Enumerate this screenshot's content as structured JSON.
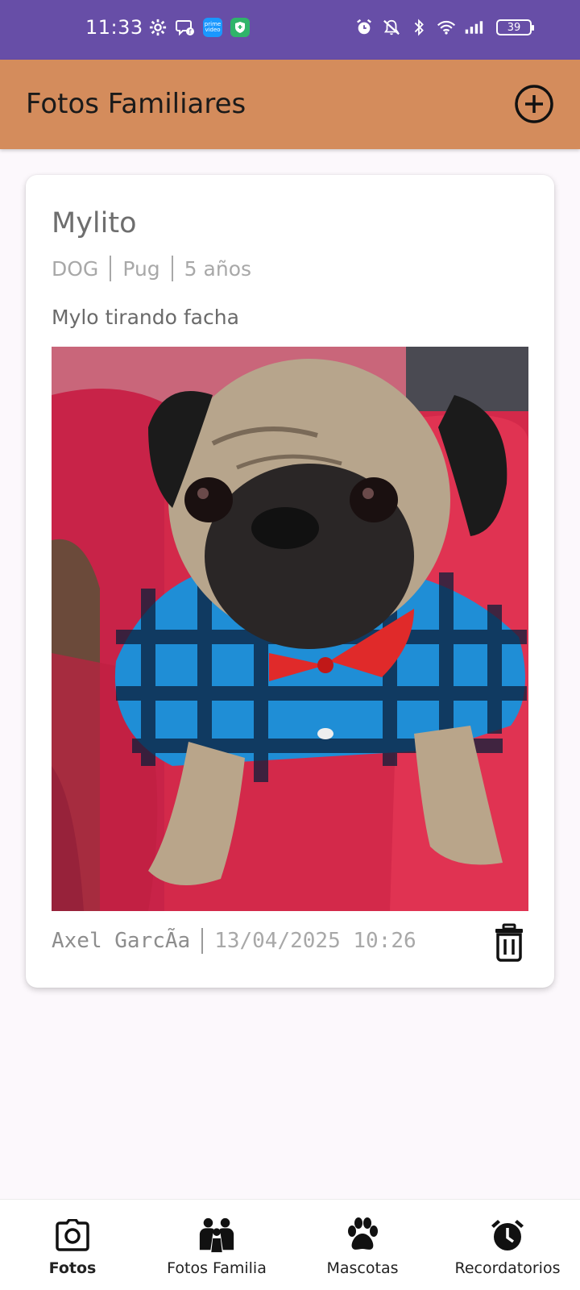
{
  "status_bar": {
    "time": "11:33",
    "prime_badge": "prime video",
    "battery": "39",
    "bg_color": "#674ea7"
  },
  "app_bar": {
    "title": "Fotos Familiares",
    "add_icon": "plus-circle-icon",
    "bg_color": "#d48c5c"
  },
  "post": {
    "name": "Mylito",
    "species": "DOG",
    "breed": "Pug",
    "age": "5 años",
    "description": "Mylo tirando facha",
    "photo_icon": "pet-photo",
    "author": "Axel GarcÃa",
    "date": "13/04/2025 10:26",
    "delete_icon": "trash-icon"
  },
  "bottom_nav": {
    "items": [
      {
        "label": "Fotos",
        "icon": "camera-icon",
        "active": true
      },
      {
        "label": "Fotos Familia",
        "icon": "family-icon",
        "active": false
      },
      {
        "label": "Mascotas",
        "icon": "paw-icon",
        "active": false
      },
      {
        "label": "Recordatorios",
        "icon": "alarm-clock-icon",
        "active": false
      }
    ]
  }
}
